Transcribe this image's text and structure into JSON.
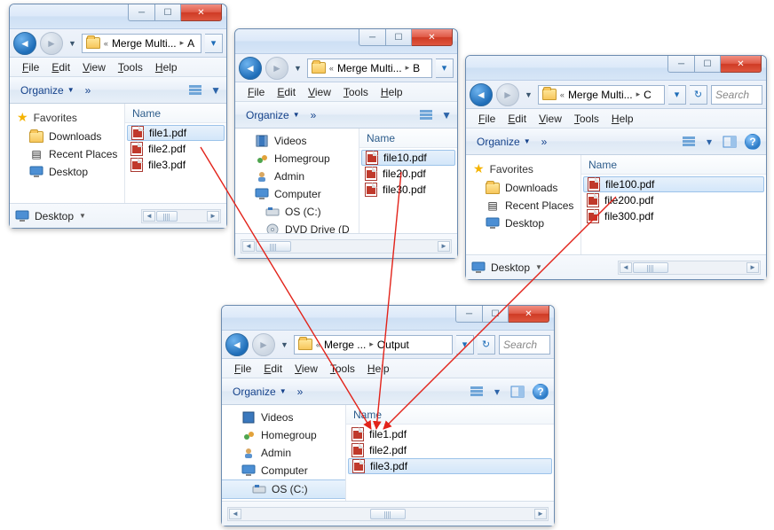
{
  "menus": {
    "file": "File",
    "edit": "Edit",
    "view": "View",
    "tools": "Tools",
    "help": "Help"
  },
  "toolbar": {
    "organize": "Organize",
    "chevrons": "»"
  },
  "columns": {
    "name": "Name"
  },
  "search_placeholder": "Search",
  "sidebar_groups": {
    "favorites": {
      "title": "Favorites",
      "items": [
        "Downloads",
        "Recent Places",
        "Desktop"
      ]
    },
    "desktop": "Desktop",
    "videos": "Videos",
    "homegroup": "Homegroup",
    "admin": "Admin",
    "computer": "Computer",
    "osc": "OS (C:)",
    "dvd": "DVD Drive (D"
  },
  "windows": {
    "a": {
      "breadcrumb": [
        "Merge Multi...",
        "A"
      ],
      "files": [
        "file1.pdf",
        "file2.pdf",
        "file3.pdf"
      ],
      "selected_file": 0
    },
    "b": {
      "breadcrumb": [
        "Merge Multi...",
        "B"
      ],
      "files": [
        "file10.pdf",
        "file20.pdf",
        "file30.pdf"
      ],
      "selected_file": 0
    },
    "c": {
      "breadcrumb": [
        "Merge Multi...",
        "C"
      ],
      "files": [
        "file100.pdf",
        "file200.pdf",
        "file300.pdf"
      ],
      "selected_file": 0
    },
    "out": {
      "breadcrumb": [
        "Merge ...",
        "Output"
      ],
      "files": [
        "file1.pdf",
        "file2.pdf",
        "file3.pdf"
      ],
      "selected_file": 2
    }
  }
}
